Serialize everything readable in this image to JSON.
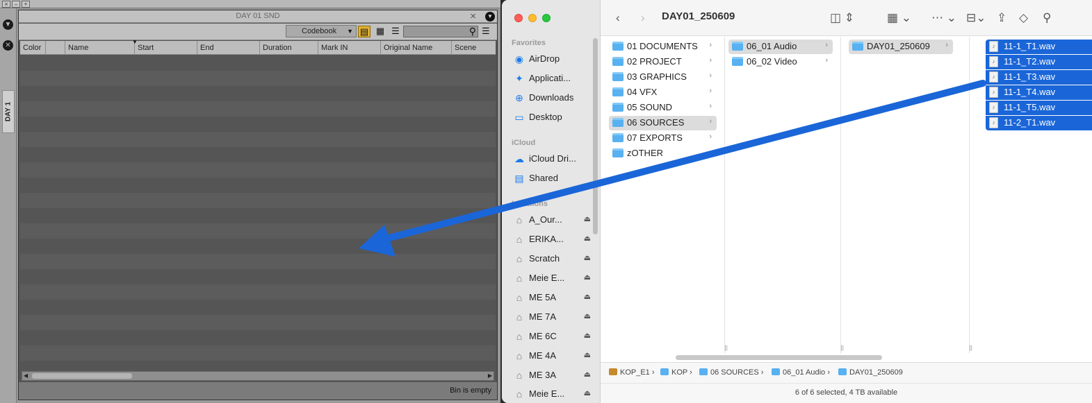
{
  "avid": {
    "bin_title": "DAY 01 SND",
    "side_tab": "DAY 1",
    "codebook": "Codebook",
    "columns": [
      "Color",
      "Name",
      "Start",
      "End",
      "Duration",
      "Mark IN",
      "Original Name",
      "Scene"
    ],
    "status": "Bin is empty"
  },
  "finder": {
    "title": "DAY01_250609",
    "sidebar": {
      "favorites_header": "Favorites",
      "favorites": [
        {
          "label": "AirDrop",
          "icon": "airdrop-icon"
        },
        {
          "label": "Applicati...",
          "icon": "applications-icon"
        },
        {
          "label": "Downloads",
          "icon": "downloads-icon"
        },
        {
          "label": "Desktop",
          "icon": "desktop-icon"
        }
      ],
      "icloud_header": "iCloud",
      "icloud": [
        {
          "label": "iCloud Dri...",
          "icon": "cloud-icon"
        },
        {
          "label": "Shared",
          "icon": "shared-folder-icon"
        }
      ],
      "locations_header": "Locations",
      "locations": [
        "A_Our...",
        "ERIKA...",
        "Scratch",
        "Meie E...",
        "ME 5A",
        "ME 7A",
        "ME 6C",
        "ME 4A",
        "ME 3A",
        "Meie E..."
      ]
    },
    "column1": [
      "01 DOCUMENTS",
      "02 PROJECT",
      "03 GRAPHICS",
      "04 VFX",
      "05 SOUND",
      "06 SOURCES",
      "07 EXPORTS",
      "zOTHER"
    ],
    "column2": [
      "06_01 Audio",
      "06_02 Video"
    ],
    "column3": [
      "DAY01_250609"
    ],
    "column4": [
      "11-1_T1.wav",
      "11-1_T2.wav",
      "11-1_T3.wav",
      "11-1_T4.wav",
      "11-1_T5.wav",
      "11-2_T1.wav"
    ],
    "path": [
      "KOP_E1",
      "KOP",
      "06 SOURCES",
      "06_01 Audio",
      "DAY01_250609"
    ],
    "status": "6 of 6 selected, 4 TB available"
  },
  "colors": {
    "selection_blue": "#1a66d8",
    "arrow_blue": "#1a66d8",
    "folder_blue": "#58b1f0"
  }
}
